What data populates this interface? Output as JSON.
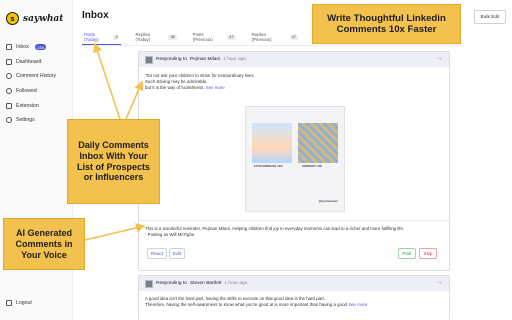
{
  "brand": {
    "name": "saywhat",
    "logo_letter": "s"
  },
  "sidebar": {
    "items": [
      {
        "label": "Inbox",
        "badge": "248",
        "icon": "inbox-icon"
      },
      {
        "label": "Dashboard",
        "icon": "dashboard-icon"
      },
      {
        "label": "Comment History",
        "icon": "history-icon"
      },
      {
        "label": "Followed",
        "icon": "followed-icon"
      },
      {
        "label": "Extension",
        "icon": "extension-icon"
      },
      {
        "label": "Settings",
        "icon": "gear-icon"
      }
    ],
    "logout": "Logout"
  },
  "header": {
    "title": "Inbox",
    "bulk_edit": "Bulk Edit"
  },
  "tabs": [
    {
      "label": "Posts (Today)",
      "count": "3",
      "active": true
    },
    {
      "label": "Replies (Today)",
      "count": "38"
    },
    {
      "label": "Posts (Previous)",
      "count": "47"
    },
    {
      "label": "Replies (Previous)",
      "count": "47"
    }
  ],
  "cards": [
    {
      "header_prefix": "Responding to",
      "author": "Pejman Milani",
      "time": "1 hour ago",
      "post_lines": [
        "\"Do not ask your children to strive for extraordinary lives.",
        "Such striving may be admirable,",
        "but it is the way of foolishness."
      ],
      "see_more": "See more",
      "image": {
        "caption_left": "EXTRAORDINARY LIFE",
        "caption_right": "ORDINARY LIFE",
        "signature": "@sketchplanator"
      },
      "reply_lines": [
        "This is a wonderful reminder, Pejman Milani. Helping children find joy in everyday moments can lead to a richer and more fulfilling life.",
        "- Posting as Will McTighe"
      ],
      "buttons": {
        "react": "React",
        "edit": "Edit",
        "post": "Post",
        "skip": "Skip"
      }
    },
    {
      "header_prefix": "Responding to",
      "author": "Steven Bartlett",
      "time": "1 hour ago",
      "post_lines": [
        "A good idea isn't the hard part, having the skills to execute on that good idea is the hard part.",
        "Therefore, having the self-awareness to know what you're good at is more important than having a good"
      ],
      "see_more": "See more"
    }
  ],
  "callouts": {
    "linkedin": "Write Thoughtful Linkedin Comments 10x Faster",
    "daily": "Daily Comments Inbox With Your List of Prospects or Influencers",
    "ai": "AI Generated Comments in Your Voice"
  },
  "colors": {
    "accent": "#4f56d8",
    "callout": "#f2c14e",
    "post": "#2e9b4f",
    "skip": "#d23c3c"
  }
}
